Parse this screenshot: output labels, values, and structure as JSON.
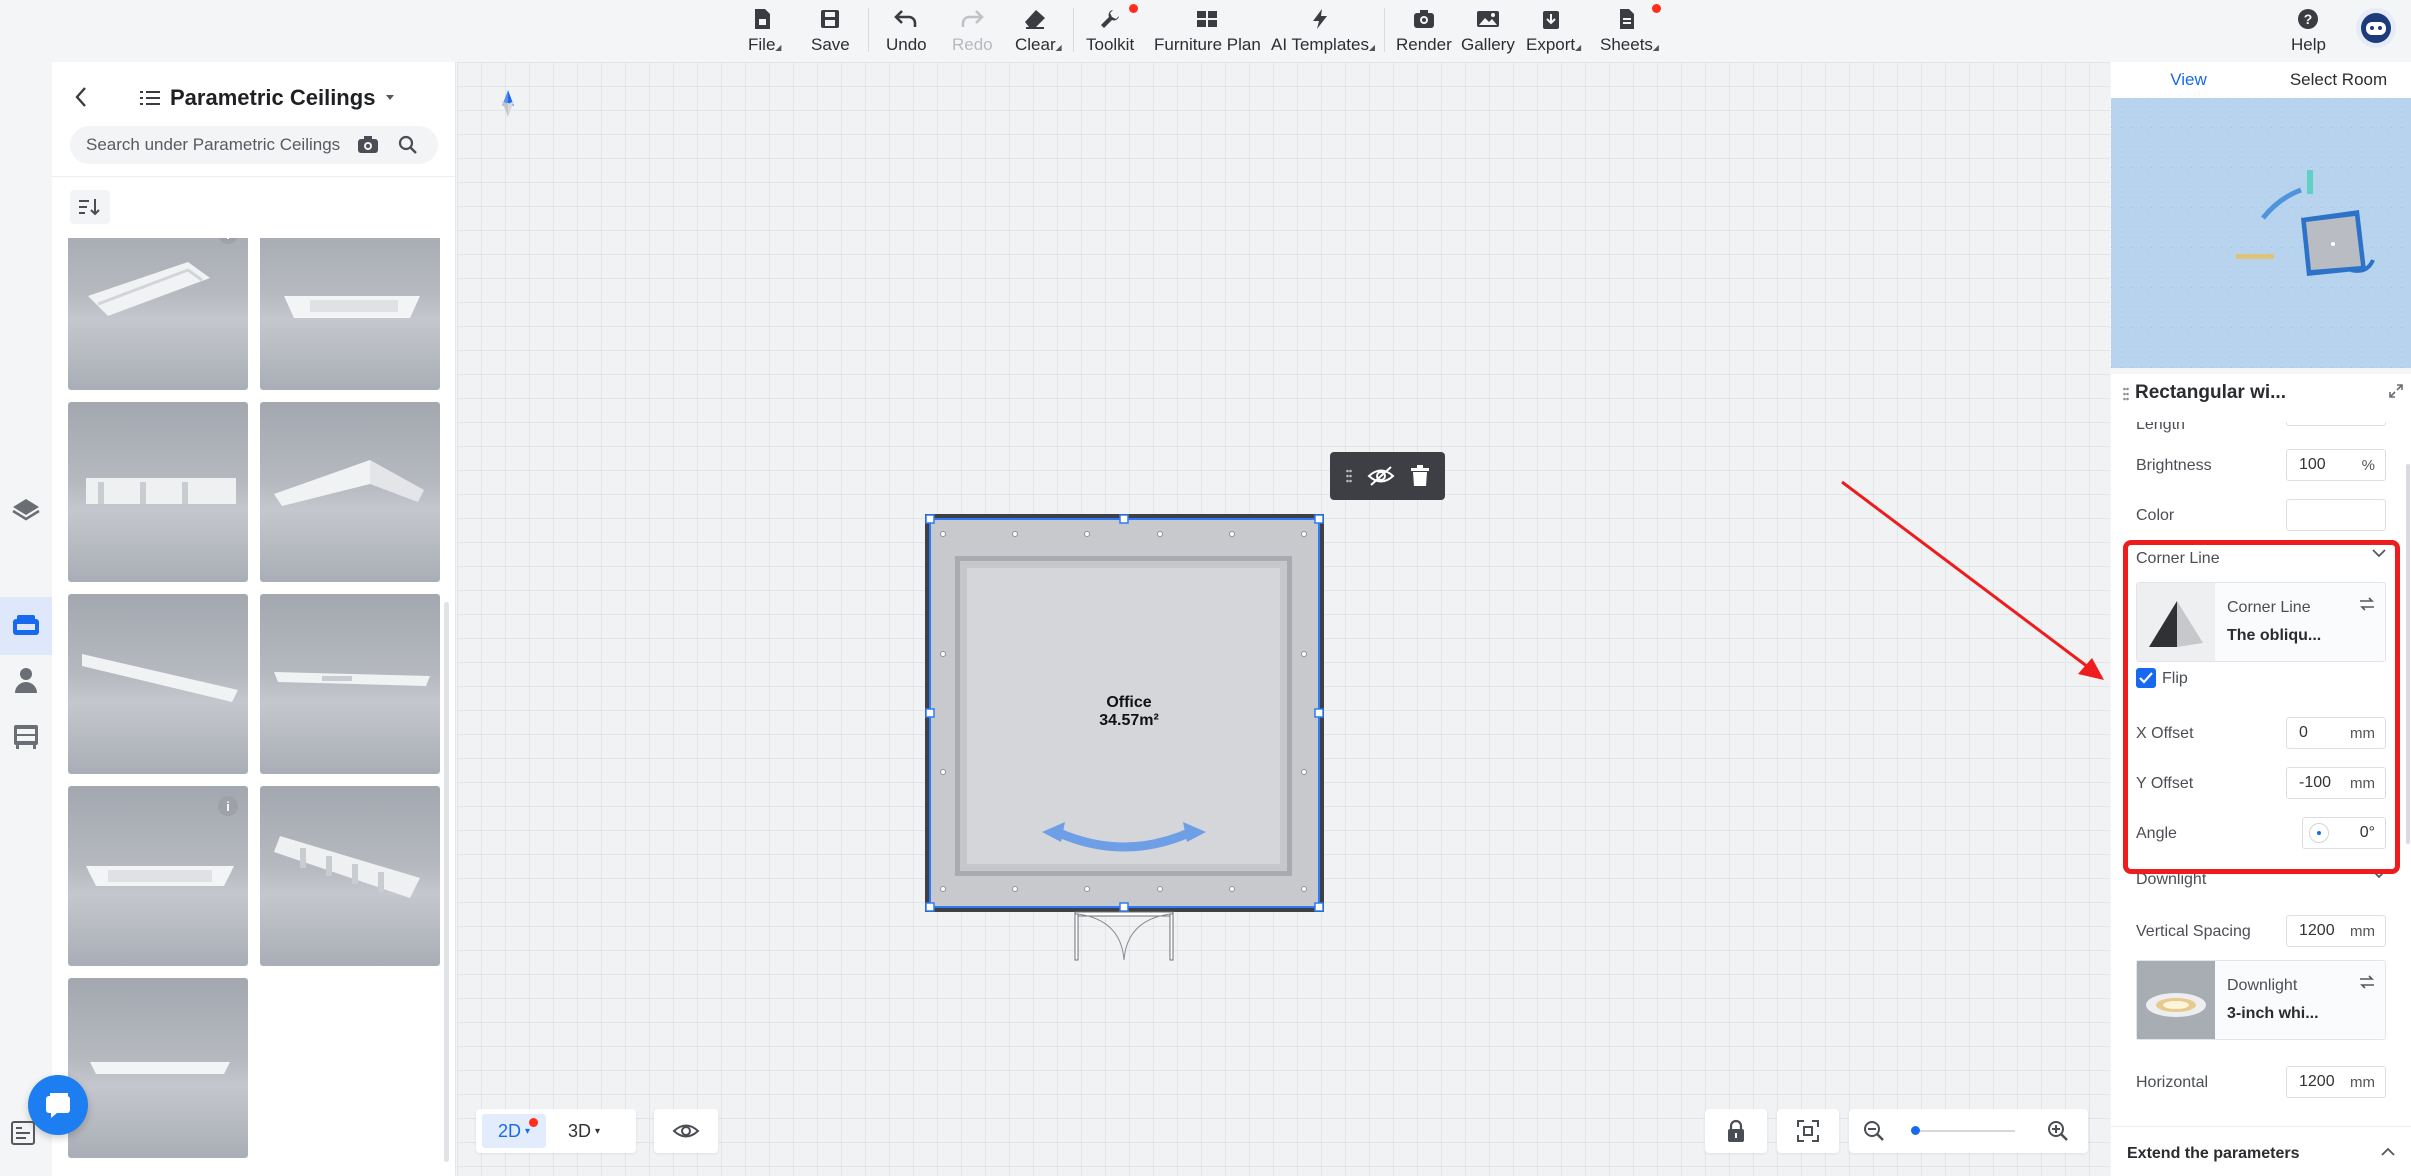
{
  "toolbar": {
    "file": "File",
    "save": "Save",
    "undo": "Undo",
    "redo": "Redo",
    "clear": "Clear",
    "toolkit": "Toolkit",
    "furniture_plan": "Furniture Plan",
    "ai_templates": "AI Templates",
    "render": "Render",
    "gallery": "Gallery",
    "export": "Export",
    "sheets": "Sheets",
    "help": "Help"
  },
  "library": {
    "title": "Parametric Ceilings",
    "search_placeholder": "Search under Parametric Ceilings"
  },
  "canvas": {
    "room_name": "Office",
    "room_area": "34.57m²",
    "view_2d": "2D",
    "view_3d": "3D"
  },
  "right_panel": {
    "tabs": [
      "View",
      "Select Room"
    ],
    "props_title": "Rectangular wi...",
    "length_label": "Length",
    "brightness_label": "Brightness",
    "brightness_value": "100",
    "brightness_unit": "%",
    "color_label": "Color",
    "corner_line": {
      "section": "Corner Line",
      "material_name": "Corner Line",
      "material_sub": "The obliqu...",
      "flip_label": "Flip",
      "flip_checked": true,
      "x_offset_label": "X Offset",
      "x_offset_value": "0",
      "y_offset_label": "Y Offset",
      "y_offset_value": "-100",
      "angle_label": "Angle",
      "angle_value": "0°",
      "unit": "mm"
    },
    "downlight": {
      "section": "Downlight",
      "vertical_spacing_label": "Vertical Spacing",
      "vertical_spacing_value": "1200",
      "material_name": "Downlight",
      "material_sub": "3-inch whi...",
      "horizontal_label": "Horizontal",
      "horizontal_value": "1200",
      "unit": "mm"
    },
    "extend_label": "Extend the parameters"
  },
  "colors": {
    "accent": "#1769f0",
    "highlight": "#ee1c1c",
    "notify": "#ff2d1a"
  }
}
